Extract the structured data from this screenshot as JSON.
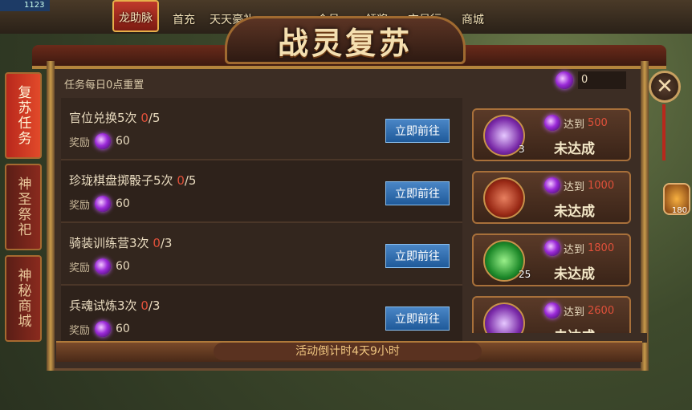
{
  "hud": {
    "fps": "1123",
    "potion_count": "180"
  },
  "topnav": [
    "龙助脉",
    "首充",
    "天天豪礼",
    "",
    "会员",
    "领奖",
    "交易行",
    "商城"
  ],
  "title": "战灵复苏",
  "sidebar": [
    {
      "label": "复苏任务",
      "active": true
    },
    {
      "label": "神圣祭祀",
      "active": false
    },
    {
      "label": "神秘商城",
      "active": false
    }
  ],
  "reset_note": "任务每日0点重置",
  "points": "0",
  "tasks": [
    {
      "name": "官位兑换5次",
      "cur": "0",
      "total": "/5",
      "reward_label": "奖励",
      "reward": "60",
      "button": "立即前往"
    },
    {
      "name": "珍珑棋盘掷骰子5次",
      "cur": "0",
      "total": "/5",
      "reward_label": "奖励",
      "reward": "60",
      "button": "立即前往"
    },
    {
      "name": "骑装训练营3次",
      "cur": "0",
      "total": "/3",
      "reward_label": "奖励",
      "reward": "60",
      "button": "立即前往"
    },
    {
      "name": "兵魂试炼3次",
      "cur": "0",
      "total": "/3",
      "reward_label": "奖励",
      "reward": "60",
      "button": "立即前往"
    }
  ],
  "milestones": [
    {
      "reach_label": "达到",
      "target": "500",
      "status": "未达成",
      "count": "3",
      "icon": "purple-orb-icon"
    },
    {
      "reach_label": "达到",
      "target": "1000",
      "status": "未达成",
      "count": "",
      "icon": "red-token-icon"
    },
    {
      "reach_label": "达到",
      "target": "1800",
      "status": "未达成",
      "count": "25",
      "icon": "green-jade-icon"
    },
    {
      "reach_label": "达到",
      "target": "2600",
      "status": "未达成",
      "count": "",
      "icon": "purple-orb-icon"
    }
  ],
  "countdown": "活动倒计时4天9小时",
  "colors": {
    "accent_red": "#e0503a",
    "button_blue": "#2f6fb0",
    "gold": "#c8924a"
  }
}
